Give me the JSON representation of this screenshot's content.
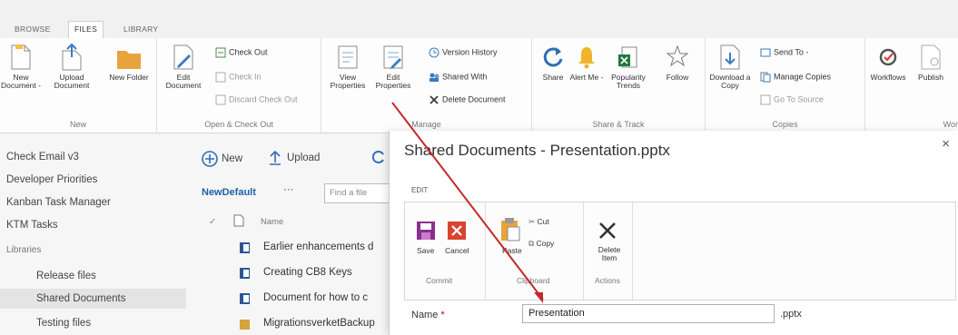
{
  "tabs": [
    {
      "label": "BROWSE"
    },
    {
      "label": "FILES"
    },
    {
      "label": "LIBRARY"
    }
  ],
  "ribbon": {
    "new_group": {
      "label": "New",
      "new_document": "New Document -",
      "upload_document": "Upload Document",
      "new_folder": "New Folder"
    },
    "open_group": {
      "label": "Open & Check Out",
      "edit_document": "Edit Document",
      "check_out": "Check Out",
      "check_in": "Check In",
      "discard_check_out": "Discard Check Out"
    },
    "manage_group": {
      "label": "Manage",
      "view_properties": "View Properties",
      "edit_properties": "Edit Properties",
      "version_history": "Version History",
      "shared_with": "Shared With",
      "delete_document": "Delete Document"
    },
    "share_group": {
      "label": "Share & Track",
      "share": "Share",
      "alert_me": "Alert Me -",
      "popularity_trends": "Popularity Trends",
      "follow": "Follow"
    },
    "copies_group": {
      "label": "Copies",
      "download_copy": "Download a Copy",
      "send_to": "Send To -",
      "manage_copies": "Manage Copies",
      "go_to_source": "Go To Source"
    },
    "workflows_group": {
      "label": "Wor",
      "workflows": "Workflows",
      "publish": "Publish"
    }
  },
  "left_nav": {
    "items": [
      {
        "label": "Check Email v3"
      },
      {
        "label": "Developer Priorities"
      },
      {
        "label": "Kanban Task Manager"
      },
      {
        "label": "KTM Tasks"
      },
      {
        "label": "Libraries"
      },
      {
        "label": "Release files"
      },
      {
        "label": "Shared Documents"
      },
      {
        "label": "Testing files"
      }
    ]
  },
  "doclist": {
    "new_label": "New",
    "upload_label": "Upload",
    "view_label": "NewDefault",
    "more_label": "···",
    "search_placeholder": "Find a file",
    "column_name": "Name",
    "rows": [
      {
        "name": "Earlier enhancements d"
      },
      {
        "name": "Creating CB8 Keys"
      },
      {
        "name": "Document for how to c"
      },
      {
        "name": "MigrationsverketBackup"
      }
    ]
  },
  "dialog": {
    "title": "Shared Documents - Presentation.pptx",
    "close": "×",
    "tab": "EDIT",
    "commit_group": "Commit",
    "clipboard_group": "Clipboard",
    "actions_group": "Actions",
    "save": "Save",
    "cancel": "Cancel",
    "paste": "Paste",
    "cut": "Cut",
    "copy": "Copy",
    "delete_item": "Delete Item",
    "name_label": "Name",
    "required_mark": "*",
    "name_value": "Presentation",
    "extension": ".pptx"
  },
  "colors": {
    "accent": "#0072c6",
    "save": "#8a2f8e",
    "cancel": "#d9432f",
    "arrow": "#c62828"
  }
}
